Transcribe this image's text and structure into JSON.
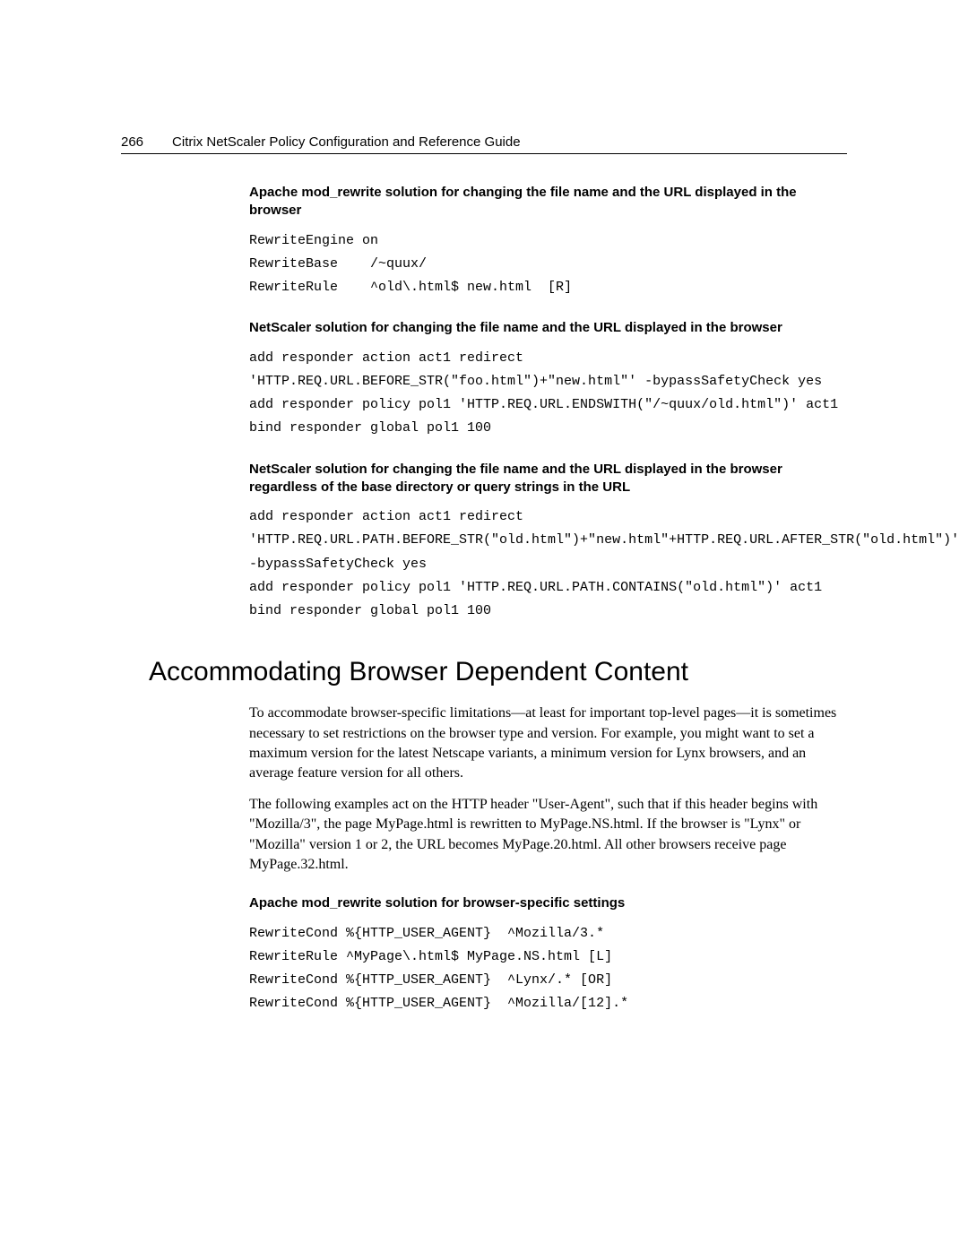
{
  "header": {
    "page_number": "266",
    "title": "Citrix NetScaler Policy Configuration and Reference Guide"
  },
  "section1": {
    "heading": "Apache mod_rewrite solution for changing the file name and the URL displayed in the browser",
    "code": [
      "RewriteEngine on",
      "RewriteBase    /~quux/",
      "RewriteRule    ^old\\.html$ new.html  [R]"
    ]
  },
  "section2": {
    "heading": "NetScaler solution for changing the file name and the URL displayed in the browser",
    "code": [
      "add responder action act1 redirect 'HTTP.REQ.URL.BEFORE_STR(\"foo.html\")+\"new.html\"' -bypassSafetyCheck yes",
      "add responder policy pol1 'HTTP.REQ.URL.ENDSWITH(\"/~quux/old.html\")' act1",
      "bind responder global pol1 100"
    ]
  },
  "section3": {
    "heading": "NetScaler solution for changing the file name and the URL displayed in the browser regardless of the base directory or query strings in the URL",
    "code": [
      "add responder action act1 redirect 'HTTP.REQ.URL.PATH.BEFORE_STR(\"old.html\")+\"new.html\"+HTTP.REQ.URL.AFTER_STR(\"old.html\")' -bypassSafetyCheck yes",
      "add responder policy pol1 'HTTP.REQ.URL.PATH.CONTAINS(\"old.html\")' act1",
      "bind responder global pol1 100"
    ]
  },
  "main_section": {
    "heading": "Accommodating Browser Dependent Content",
    "paragraphs": [
      "To accommodate browser-specific limitations—at least for important top-level pages—it is sometimes necessary to set restrictions on the browser type and version. For example, you might want to set a maximum version for the latest Netscape variants, a minimum version for Lynx browsers, and an average feature version for all others.",
      "The following examples act on the HTTP header \"User-Agent\", such that if this header begins with \"Mozilla/3\", the page MyPage.html is rewritten to MyPage.NS.html. If the browser is \"Lynx\" or \"Mozilla\" version 1 or 2, the URL becomes MyPage.20.html. All other browsers receive page MyPage.32.html."
    ]
  },
  "section4": {
    "heading": "Apache mod_rewrite solution for browser-specific settings",
    "code": [
      "RewriteCond %{HTTP_USER_AGENT}  ^Mozilla/3.*",
      "RewriteRule ^MyPage\\.html$ MyPage.NS.html [L]",
      "RewriteCond %{HTTP_USER_AGENT}  ^Lynx/.* [OR]",
      "RewriteCond %{HTTP_USER_AGENT}  ^Mozilla/[12].*"
    ]
  }
}
